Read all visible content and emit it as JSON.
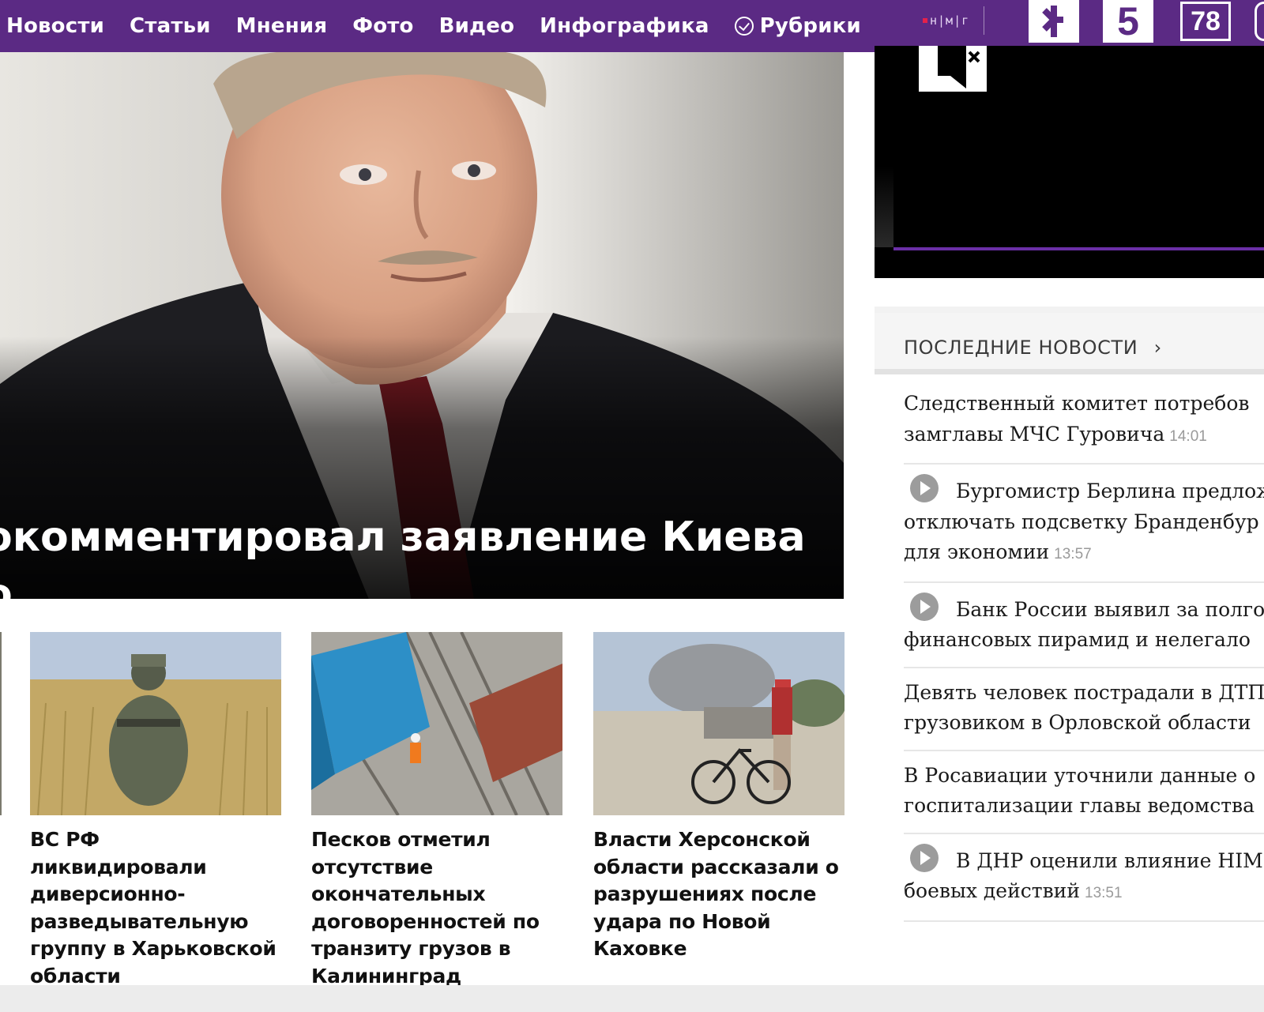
{
  "nav": {
    "items": [
      "Новости",
      "Статьи",
      "Мнения",
      "Фото",
      "Видео",
      "Инфографика"
    ],
    "rubrics_label": "Рубрики",
    "nmg": "н|м|г",
    "channels": [
      "Рен",
      "5",
      "78"
    ]
  },
  "hero": {
    "title": "окомментировал заявление Киева о\nм соглашении по зерну"
  },
  "cards": [
    {
      "title": "ВС РФ ликвидировали диверсионно-разведывательную группу в Харьковской области"
    },
    {
      "title": "Песков отметил отсутствие окончательных договоренностей по транзиту грузов в Калининград"
    },
    {
      "title": "Власти Херсонской области рассказали о разрушениях после удара по Новой Каховке"
    }
  ],
  "latest": {
    "title": "ПОСЛЕДНИЕ НОВОСТИ",
    "chevron": "›",
    "items": [
      {
        "line1": "Следственный комитет потребов",
        "line2": "замглавы МЧС Гуровича",
        "time": "14:01",
        "video": false
      },
      {
        "line1": "Бургомистр Берлина предлож",
        "line2": "отключать подсветку Бранденбур",
        "line3": "для экономии",
        "time": "13:57",
        "video": true
      },
      {
        "line1": "Банк России выявил за полго",
        "line2": "финансовых пирамид и нелегало",
        "time": "",
        "video": true
      },
      {
        "line1": "Девять человек пострадали в ДТП",
        "line2": "грузовиком в Орловской области",
        "time": "",
        "video": false
      },
      {
        "line1": "В Росавиации уточнили данные о",
        "line2": "госпитализации главы ведомства",
        "time": "",
        "video": false
      },
      {
        "line1": "В ДНР оценили влияние HIM",
        "line2": "боевых действий",
        "time": "13:51",
        "video": true
      }
    ]
  },
  "colors": {
    "nav_bg": "#5b2a84",
    "accent_bar": "#6b2fa6"
  }
}
